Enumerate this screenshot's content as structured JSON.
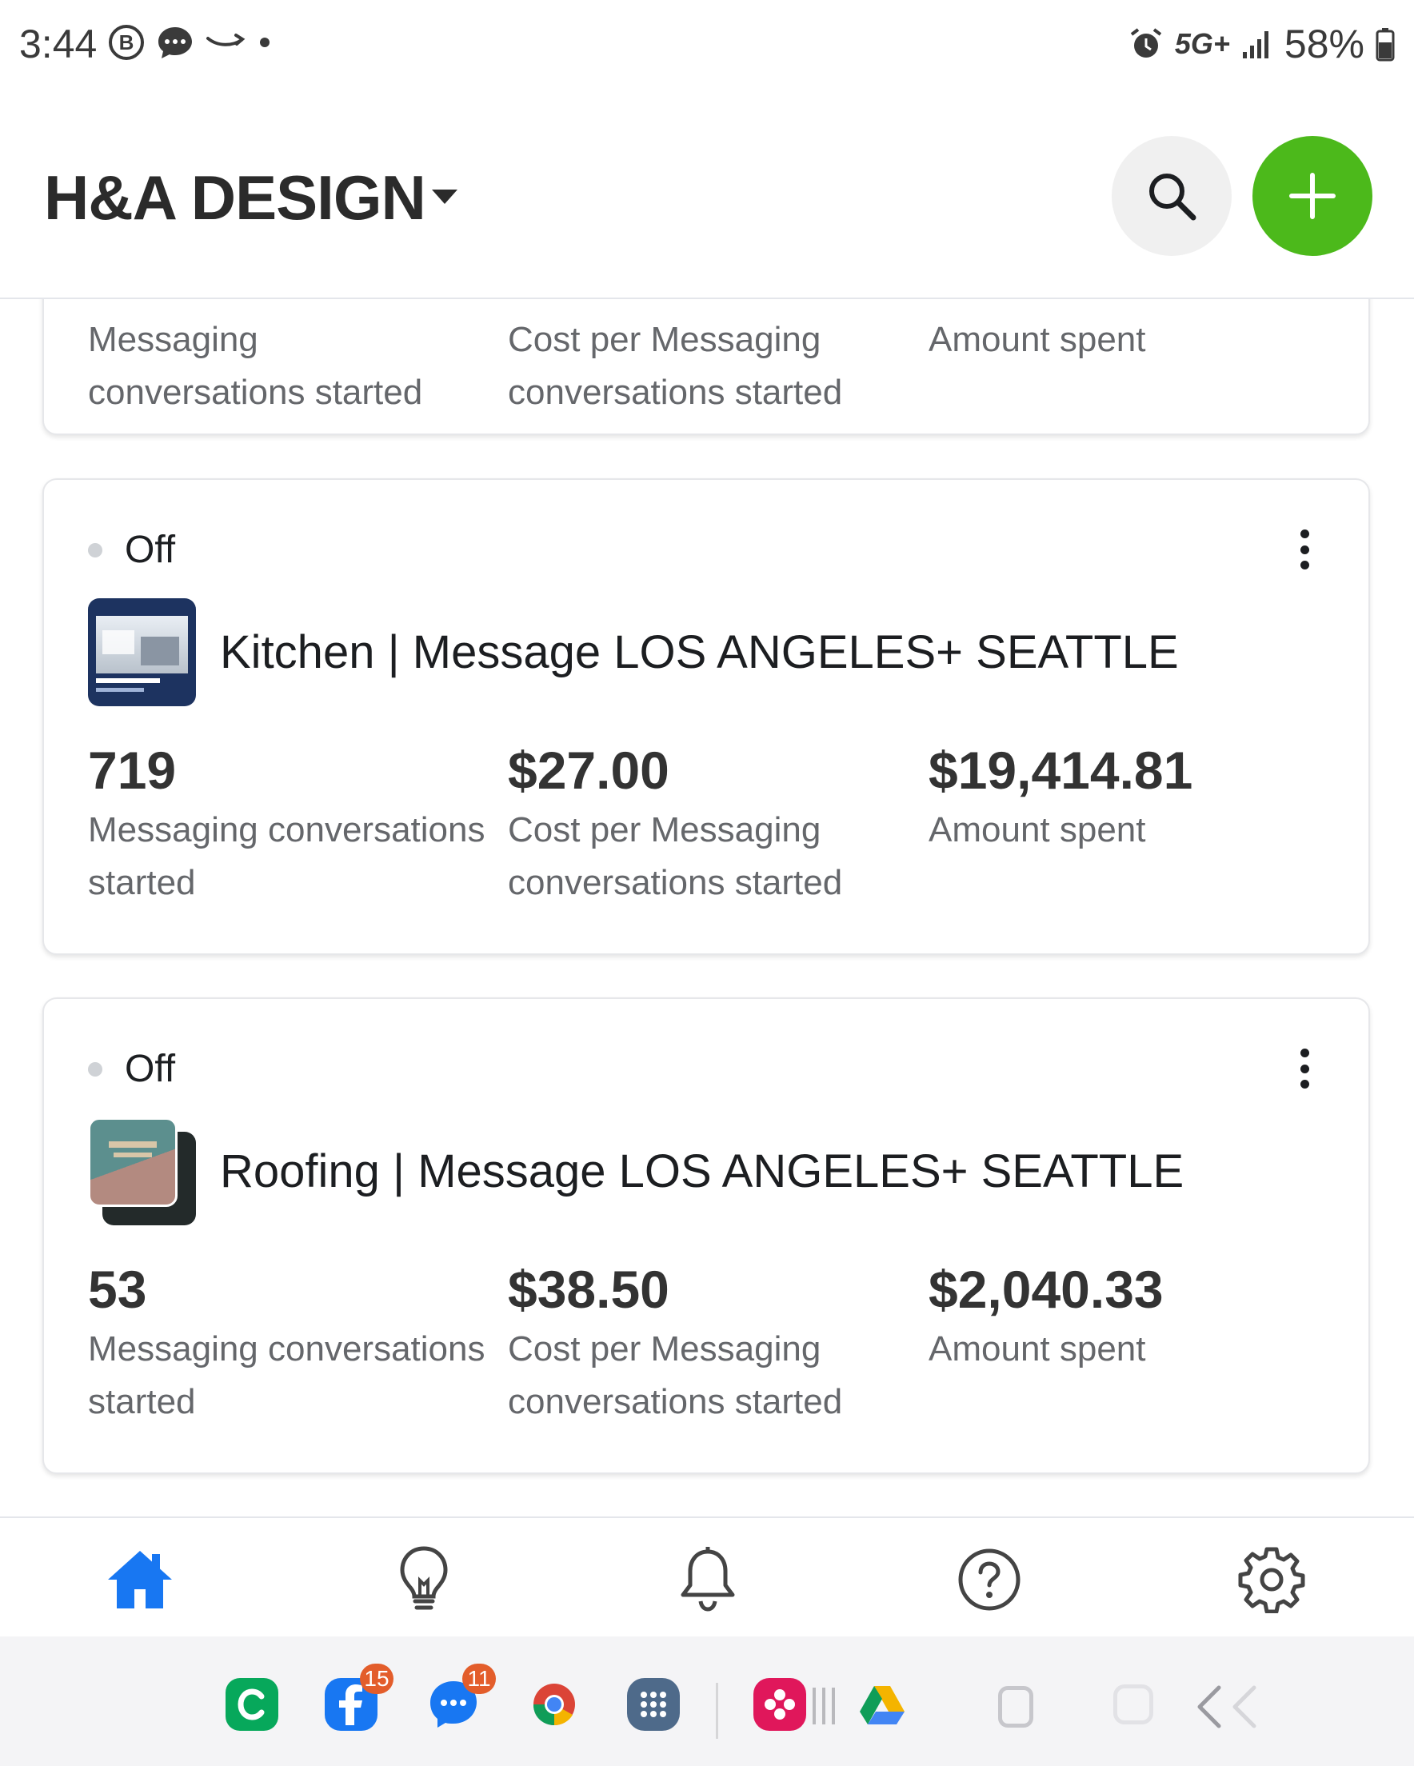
{
  "status_bar": {
    "time": "3:44",
    "network": "5G+",
    "battery": "58%"
  },
  "header": {
    "account_name": "H&A DESIGN"
  },
  "partial_card": {
    "labels": [
      "Messaging\nconversations started",
      "Cost per Messaging\nconversations started",
      "Amount spent"
    ]
  },
  "campaigns": [
    {
      "status": "Off",
      "name": "Kitchen | Message LOS ANGELES+ SEATTLE",
      "metrics": [
        {
          "value": "719",
          "label": "Messaging conversations started"
        },
        {
          "value": "$27.00",
          "label": "Cost per Messaging conversations started"
        },
        {
          "value": "$19,414.81",
          "label": "Amount spent"
        }
      ]
    },
    {
      "status": "Off",
      "name": "Roofing | Message LOS ANGELES+ SEATTLE",
      "metrics": [
        {
          "value": "53",
          "label": "Messaging conversations started"
        },
        {
          "value": "$38.50",
          "label": "Cost per Messaging conversations started"
        },
        {
          "value": "$2,040.33",
          "label": "Amount spent"
        }
      ]
    }
  ],
  "partial_labels": {
    "m1": "Messaging conversations started",
    "m2": "Cost per Messaging conversations started",
    "m3": "Amount spent"
  },
  "tabs": [
    "home-icon",
    "lightbulb-icon",
    "bell-icon",
    "help-icon",
    "gear-icon"
  ],
  "nav_apps": [
    {
      "icon": "c-app-icon"
    },
    {
      "icon": "facebook-icon",
      "badge": "15"
    },
    {
      "icon": "messenger-icon",
      "badge": "11"
    },
    {
      "icon": "chrome-icon"
    },
    {
      "icon": "app-drawer-icon"
    },
    {
      "icon": "flower-app-icon"
    },
    {
      "icon": "drive-icon"
    }
  ],
  "colors": {
    "accent_green": "#4cb91b",
    "home_blue": "#1877f2",
    "status_off": "#cfd2d6"
  }
}
